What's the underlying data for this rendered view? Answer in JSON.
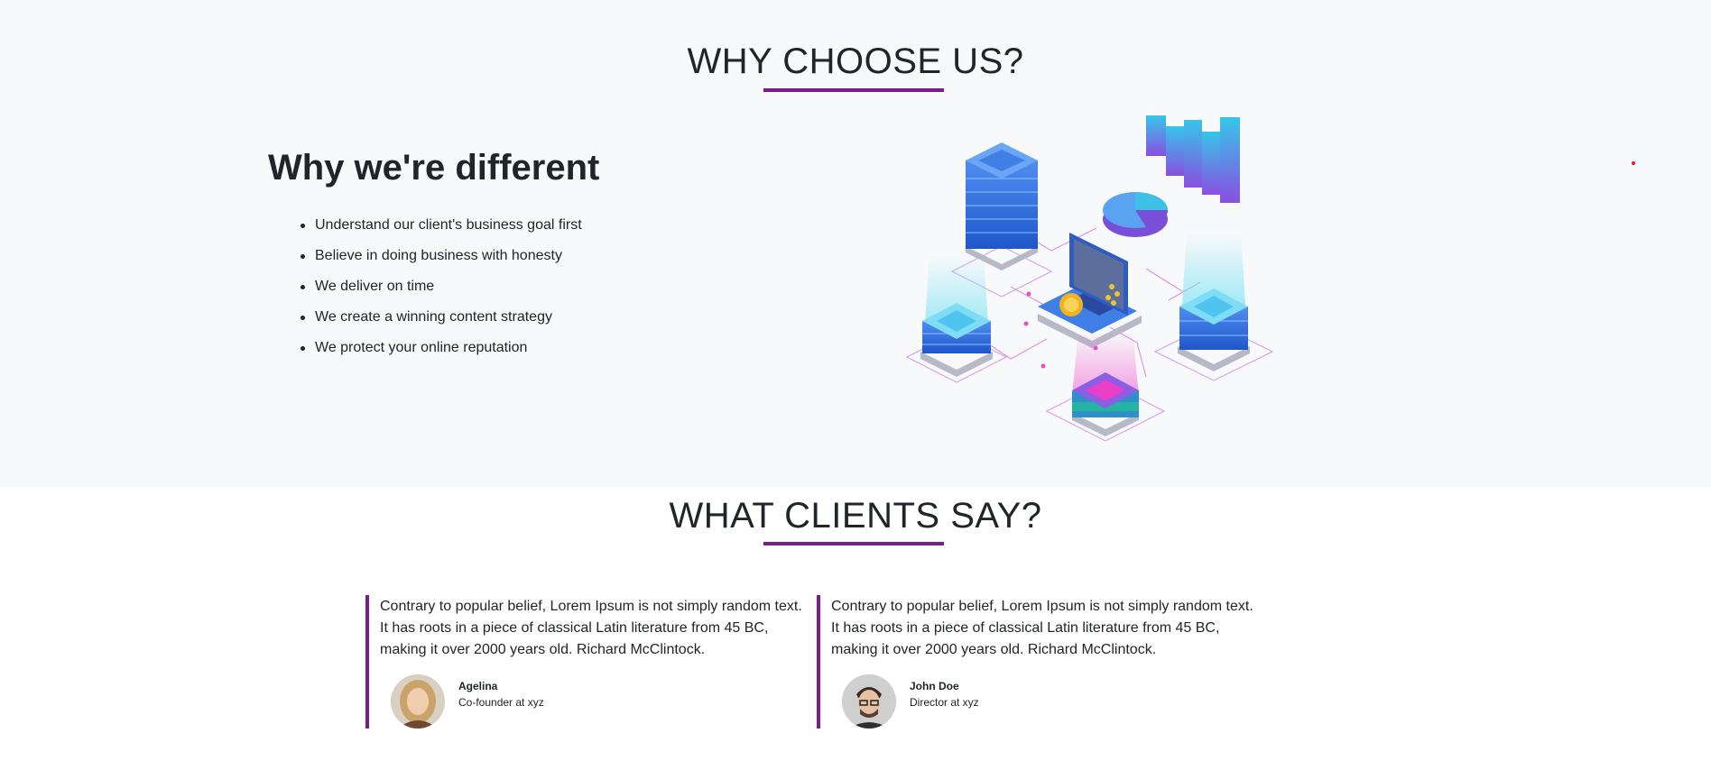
{
  "why": {
    "title": "WHY CHOOSE US?",
    "heading": "Why we're different",
    "points": [
      "Understand our client's business goal first",
      "Believe in doing business with honesty",
      "We deliver on time",
      "We create a winning content strategy",
      "We protect your online reputation"
    ]
  },
  "clients": {
    "title": "WHAT CLIENTS SAY?",
    "testimonials": [
      {
        "quote": "Contrary to popular belief, Lorem Ipsum is not simply random text. It has roots in a piece of classical Latin literature from 45 BC, making it over 2000 years old. Richard McClintock.",
        "name": "Agelina",
        "role": "Co-founder at xyz"
      },
      {
        "quote": "Contrary to popular belief, Lorem Ipsum is not simply random text. It has roots in a piece of classical Latin literature from 45 BC, making it over 2000 years old. Richard McClintock.",
        "name": "John Doe",
        "role": "Director at xyz"
      }
    ]
  },
  "colors": {
    "accent": "#7b1c8c",
    "section_bg": "#f8f9fa",
    "text": "#212529"
  }
}
